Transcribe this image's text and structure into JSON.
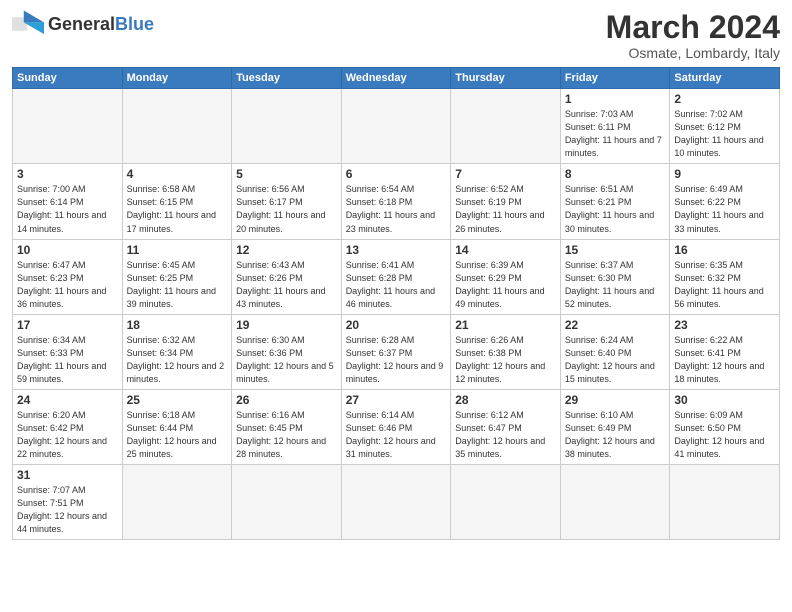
{
  "logo": {
    "text_general": "General",
    "text_blue": "Blue"
  },
  "title": "March 2024",
  "subtitle": "Osmate, Lombardy, Italy",
  "days_of_week": [
    "Sunday",
    "Monday",
    "Tuesday",
    "Wednesday",
    "Thursday",
    "Friday",
    "Saturday"
  ],
  "weeks": [
    [
      {
        "day": "",
        "info": "",
        "empty": true
      },
      {
        "day": "",
        "info": "",
        "empty": true
      },
      {
        "day": "",
        "info": "",
        "empty": true
      },
      {
        "day": "",
        "info": "",
        "empty": true
      },
      {
        "day": "",
        "info": "",
        "empty": true
      },
      {
        "day": "1",
        "info": "Sunrise: 7:03 AM\nSunset: 6:11 PM\nDaylight: 11 hours\nand 7 minutes."
      },
      {
        "day": "2",
        "info": "Sunrise: 7:02 AM\nSunset: 6:12 PM\nDaylight: 11 hours\nand 10 minutes."
      }
    ],
    [
      {
        "day": "3",
        "info": "Sunrise: 7:00 AM\nSunset: 6:14 PM\nDaylight: 11 hours\nand 14 minutes."
      },
      {
        "day": "4",
        "info": "Sunrise: 6:58 AM\nSunset: 6:15 PM\nDaylight: 11 hours\nand 17 minutes."
      },
      {
        "day": "5",
        "info": "Sunrise: 6:56 AM\nSunset: 6:17 PM\nDaylight: 11 hours\nand 20 minutes."
      },
      {
        "day": "6",
        "info": "Sunrise: 6:54 AM\nSunset: 6:18 PM\nDaylight: 11 hours\nand 23 minutes."
      },
      {
        "day": "7",
        "info": "Sunrise: 6:52 AM\nSunset: 6:19 PM\nDaylight: 11 hours\nand 26 minutes."
      },
      {
        "day": "8",
        "info": "Sunrise: 6:51 AM\nSunset: 6:21 PM\nDaylight: 11 hours\nand 30 minutes."
      },
      {
        "day": "9",
        "info": "Sunrise: 6:49 AM\nSunset: 6:22 PM\nDaylight: 11 hours\nand 33 minutes."
      }
    ],
    [
      {
        "day": "10",
        "info": "Sunrise: 6:47 AM\nSunset: 6:23 PM\nDaylight: 11 hours\nand 36 minutes."
      },
      {
        "day": "11",
        "info": "Sunrise: 6:45 AM\nSunset: 6:25 PM\nDaylight: 11 hours\nand 39 minutes."
      },
      {
        "day": "12",
        "info": "Sunrise: 6:43 AM\nSunset: 6:26 PM\nDaylight: 11 hours\nand 43 minutes."
      },
      {
        "day": "13",
        "info": "Sunrise: 6:41 AM\nSunset: 6:28 PM\nDaylight: 11 hours\nand 46 minutes."
      },
      {
        "day": "14",
        "info": "Sunrise: 6:39 AM\nSunset: 6:29 PM\nDaylight: 11 hours\nand 49 minutes."
      },
      {
        "day": "15",
        "info": "Sunrise: 6:37 AM\nSunset: 6:30 PM\nDaylight: 11 hours\nand 52 minutes."
      },
      {
        "day": "16",
        "info": "Sunrise: 6:35 AM\nSunset: 6:32 PM\nDaylight: 11 hours\nand 56 minutes."
      }
    ],
    [
      {
        "day": "17",
        "info": "Sunrise: 6:34 AM\nSunset: 6:33 PM\nDaylight: 11 hours\nand 59 minutes."
      },
      {
        "day": "18",
        "info": "Sunrise: 6:32 AM\nSunset: 6:34 PM\nDaylight: 12 hours\nand 2 minutes."
      },
      {
        "day": "19",
        "info": "Sunrise: 6:30 AM\nSunset: 6:36 PM\nDaylight: 12 hours\nand 5 minutes."
      },
      {
        "day": "20",
        "info": "Sunrise: 6:28 AM\nSunset: 6:37 PM\nDaylight: 12 hours\nand 9 minutes."
      },
      {
        "day": "21",
        "info": "Sunrise: 6:26 AM\nSunset: 6:38 PM\nDaylight: 12 hours\nand 12 minutes."
      },
      {
        "day": "22",
        "info": "Sunrise: 6:24 AM\nSunset: 6:40 PM\nDaylight: 12 hours\nand 15 minutes."
      },
      {
        "day": "23",
        "info": "Sunrise: 6:22 AM\nSunset: 6:41 PM\nDaylight: 12 hours\nand 18 minutes."
      }
    ],
    [
      {
        "day": "24",
        "info": "Sunrise: 6:20 AM\nSunset: 6:42 PM\nDaylight: 12 hours\nand 22 minutes."
      },
      {
        "day": "25",
        "info": "Sunrise: 6:18 AM\nSunset: 6:44 PM\nDaylight: 12 hours\nand 25 minutes."
      },
      {
        "day": "26",
        "info": "Sunrise: 6:16 AM\nSunset: 6:45 PM\nDaylight: 12 hours\nand 28 minutes."
      },
      {
        "day": "27",
        "info": "Sunrise: 6:14 AM\nSunset: 6:46 PM\nDaylight: 12 hours\nand 31 minutes."
      },
      {
        "day": "28",
        "info": "Sunrise: 6:12 AM\nSunset: 6:47 PM\nDaylight: 12 hours\nand 35 minutes."
      },
      {
        "day": "29",
        "info": "Sunrise: 6:10 AM\nSunset: 6:49 PM\nDaylight: 12 hours\nand 38 minutes."
      },
      {
        "day": "30",
        "info": "Sunrise: 6:09 AM\nSunset: 6:50 PM\nDaylight: 12 hours\nand 41 minutes."
      }
    ],
    [
      {
        "day": "31",
        "info": "Sunrise: 7:07 AM\nSunset: 7:51 PM\nDaylight: 12 hours\nand 44 minutes.",
        "last": true
      },
      {
        "day": "",
        "info": "",
        "empty": true,
        "last": true
      },
      {
        "day": "",
        "info": "",
        "empty": true,
        "last": true
      },
      {
        "day": "",
        "info": "",
        "empty": true,
        "last": true
      },
      {
        "day": "",
        "info": "",
        "empty": true,
        "last": true
      },
      {
        "day": "",
        "info": "",
        "empty": true,
        "last": true
      },
      {
        "day": "",
        "info": "",
        "empty": true,
        "last": true
      }
    ]
  ]
}
